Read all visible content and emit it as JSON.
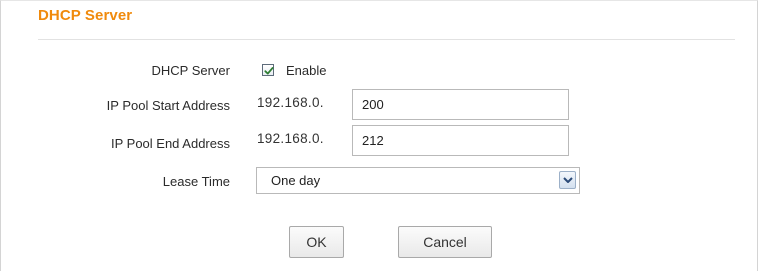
{
  "section": {
    "title": "DHCP Server"
  },
  "form": {
    "dhcp_server": {
      "label": "DHCP Server",
      "checked": true,
      "checkbox_label": "Enable"
    },
    "pool_start": {
      "label": "IP Pool Start Address",
      "prefix": "192.168.0.",
      "value": "200"
    },
    "pool_end": {
      "label": "IP Pool End Address",
      "prefix": "192.168.0.",
      "value": "212"
    },
    "lease_time": {
      "label": "Lease Time",
      "selected": "One day"
    }
  },
  "buttons": {
    "ok": "OK",
    "cancel": "Cancel"
  },
  "colors": {
    "title": "#f08a0c",
    "check": "#2e7d32"
  },
  "icons": {
    "checkbox": "check-icon",
    "dropdown": "chevron-down-icon"
  }
}
